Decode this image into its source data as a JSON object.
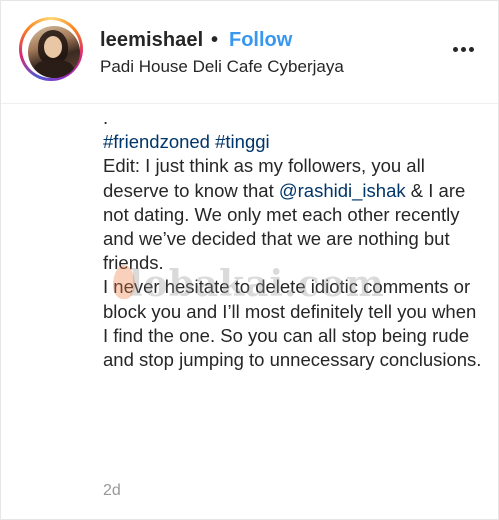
{
  "post": {
    "username": "leemishael",
    "separator": "•",
    "follow_label": "Follow",
    "location": "Padi House Deli Cafe Cyberjaya",
    "more_icon": "more-horizontal-icon"
  },
  "caption": {
    "line_dot": ".",
    "hashtag_1": "#friendzoned",
    "hashtag_2": "#tinggi",
    "edit_intro": "Edit: I just think as my followers, you all deserve to know that ",
    "mention": "@rashidi_ishak",
    "edit_rest": " & I are not dating. We only met each other recently and we’ve decided that we are nothing but friends.",
    "paragraph_2": "I never hesitate to delete idiotic comments or block you and I’ll most definitely tell you when I find the one. So you can all stop being rude and stop jumping to unnecessary conclusions."
  },
  "watermark": {
    "text": "lobakai.com"
  },
  "timestamp": "2d",
  "colors": {
    "link": "#003569",
    "follow": "#3897f0",
    "text": "#262626",
    "muted": "#999999"
  }
}
